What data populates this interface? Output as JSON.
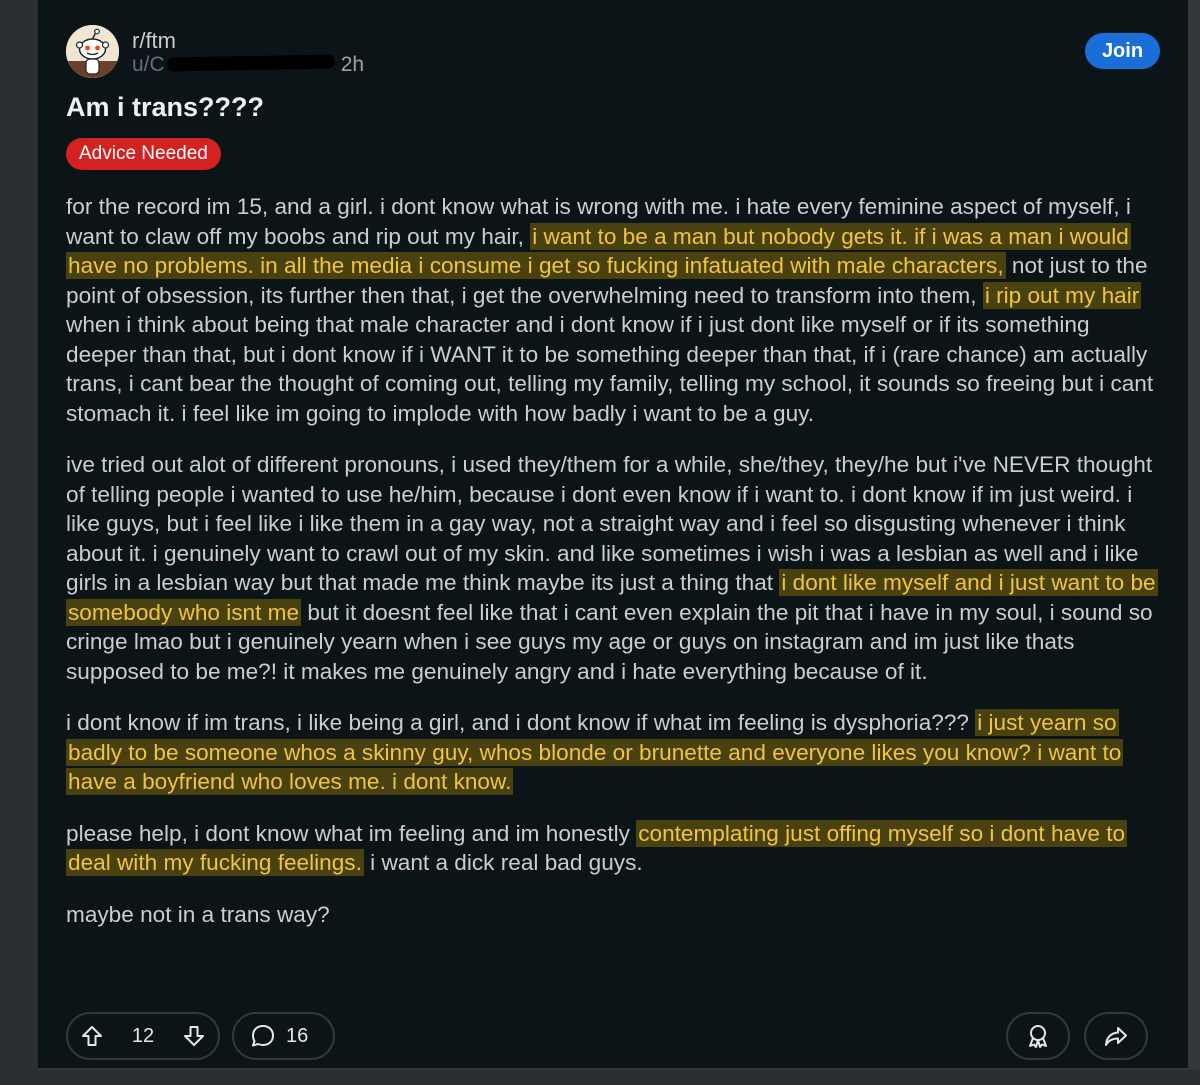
{
  "post": {
    "subreddit": "r/ftm",
    "user_prefix": "u/C",
    "time": "2h",
    "join_label": "Join",
    "title": "Am i trans????",
    "flair": "Advice Needed",
    "paragraphs": [
      [
        {
          "t": "for the record im 15, and a girl. i dont know what is wrong with me. i hate every feminine aspect of myself, i want to claw off my boobs and rip out my hair, "
        },
        {
          "t": "i want to be a man but nobody gets it. if i was a man i would have no problems. in all the media i consume i get so fucking infatuated with male characters,",
          "hl": true
        },
        {
          "t": " not just to the point of obsession, its further then that, i get the overwhelming need to transform into them, "
        },
        {
          "t": "i rip out my hair",
          "hl": true
        },
        {
          "t": " when i think about being that male character and i dont know if i just dont like myself or if its something deeper than that, but i dont know if i WANT it to be something deeper than that, if i (rare chance) am actually trans, i cant bear the thought of coming out, telling my family, telling my school, it sounds so freeing but i cant stomach it. i feel like im going to implode with how badly i want to be a guy."
        }
      ],
      [
        {
          "t": "ive tried out alot of different pronouns, i used they/them for a while, she/they, they/he but i've NEVER thought of telling people i wanted to use he/him, because i dont even know if i want to. i dont know if im just weird. i like guys, but i feel like i like them in a gay way, not a straight way and i feel so disgusting whenever i think about it. i genuinely want to crawl out of my skin. and like sometimes i wish i was a lesbian as well and i like girls in a lesbian way but that made me think maybe its just a thing that "
        },
        {
          "t": "i dont like myself and i just want to be somebody who isnt me",
          "hl": true
        },
        {
          "t": " but it doesnt feel like that i cant even explain the pit that i have in my soul, i sound so cringe lmao but i genuinely yearn when i see guys my age or guys on instagram and im just like thats supposed to be me?! it makes me genuinely angry and i hate everything because of it."
        }
      ],
      [
        {
          "t": "i dont know if im trans, i like being a girl, and i dont know if what im feeling is dysphoria??? "
        },
        {
          "t": "i just yearn so badly to be someone whos a skinny guy, whos blonde or brunette and everyone likes you know? i want to have a boyfriend who loves me. i dont know.",
          "hl": true
        }
      ],
      [
        {
          "t": "please help, i dont know what im feeling and im honestly "
        },
        {
          "t": "contemplating just offing myself so i dont have to deal with my fucking feelings.",
          "hl": true
        },
        {
          "t": " i want a dick real bad guys."
        }
      ],
      [
        {
          "t": "maybe not in a trans way?"
        }
      ]
    ]
  },
  "actions": {
    "upvotes": "12",
    "comments": "16"
  },
  "icons": {
    "avatar": "reddit-snoo-avatar",
    "upvote": "arrow-up-icon",
    "downvote": "arrow-down-icon",
    "comment": "speech-bubble-icon",
    "award": "award-icon",
    "share": "share-arrow-icon"
  },
  "colors": {
    "background": "#0b1416",
    "join_button": "#1a6ed8",
    "flair": "#d32222",
    "highlight_text": "#f0c43e"
  }
}
